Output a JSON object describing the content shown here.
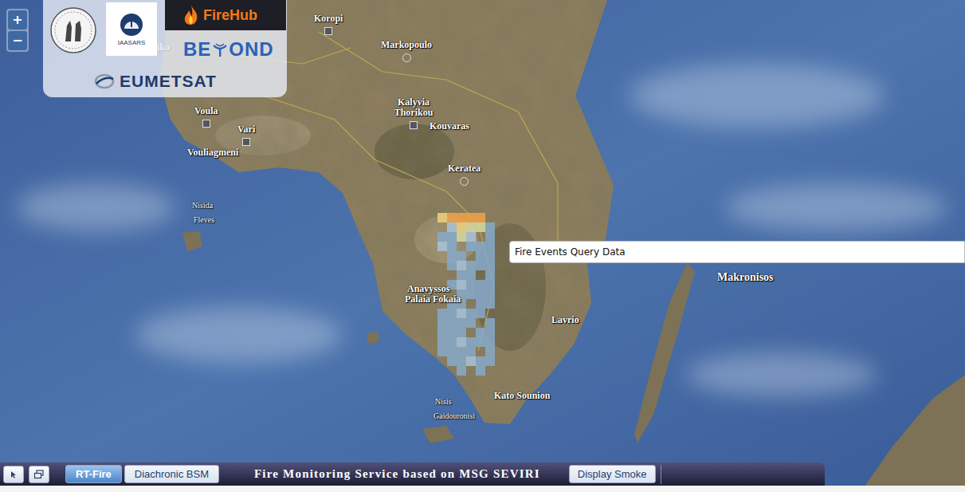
{
  "zoom": {
    "in": "+",
    "out": "−"
  },
  "logos": {
    "iaasars": "IAASARS",
    "firehub": "FireHub",
    "beyond_left": "BE",
    "beyond_right": "OND",
    "eumetsat": "EUMETSAT"
  },
  "map_labels": [
    {
      "text": "iko",
      "kind": "town",
      "marker": "none"
    },
    {
      "text": "Koropi",
      "kind": "town",
      "marker": "square"
    },
    {
      "text": "Markopoulo",
      "kind": "town",
      "marker": "circle"
    },
    {
      "text": "Voula",
      "kind": "town",
      "marker": "square"
    },
    {
      "text": "Vari",
      "kind": "town",
      "marker": "square"
    },
    {
      "text": "Vouliagmeni",
      "kind": "town",
      "marker": "none"
    },
    {
      "text": "Kalyvia Thorikou",
      "kind": "town",
      "marker": "square"
    },
    {
      "text": "Kouvaras",
      "kind": "town",
      "marker": "none"
    },
    {
      "text": "Keratea",
      "kind": "town",
      "marker": "circle"
    },
    {
      "text": "Nisida",
      "kind": "small",
      "marker": "none"
    },
    {
      "text": "Fleves",
      "kind": "small",
      "marker": "none"
    },
    {
      "text": "Anavyssos",
      "kind": "town",
      "marker": "none"
    },
    {
      "text": "Palaia Fokaia",
      "kind": "town",
      "marker": "none"
    },
    {
      "text": "Lavrio",
      "kind": "town",
      "marker": "none"
    },
    {
      "text": "Makronisos",
      "kind": "island",
      "marker": "none"
    },
    {
      "text": "Kato Sounion",
      "kind": "town",
      "marker": "none"
    },
    {
      "text": "Nisis",
      "kind": "small",
      "marker": "none"
    },
    {
      "text": "Gaidouronisi",
      "kind": "small",
      "marker": "none"
    }
  ],
  "fire_grid": [
    [
      "#f0d27a",
      "#f4a24a",
      "#f4a24a",
      "#f4a24a",
      "#f4a24a",
      null
    ],
    [
      null,
      "#a9c4da",
      "#f0d27a",
      "#d6d9a0",
      "#d6d9a0",
      "#86aacb"
    ],
    [
      "#86aacb",
      "#86aacb",
      "#d6d9a0",
      "#a9c4da",
      null,
      "#86aacb"
    ],
    [
      "#a9c4da",
      "#86aacb",
      null,
      "#86aacb",
      "#86aacb",
      "#86aacb"
    ],
    [
      null,
      "#86aacb",
      "#86aacb",
      null,
      "#86aacb",
      "#86aacb"
    ],
    [
      null,
      "#86aacb",
      "#a9c4da",
      "#86aacb",
      "#86aacb",
      "#86aacb"
    ],
    [
      null,
      null,
      "#86aacb",
      "#86aacb",
      null,
      "#86aacb"
    ],
    [
      null,
      "#86aacb",
      "#a9c4da",
      "#86aacb",
      "#86aacb",
      "#86aacb"
    ],
    [
      null,
      null,
      "#86aacb",
      "#86aacb",
      "#86aacb",
      "#86aacb"
    ],
    [
      null,
      "#86aacb",
      "#86aacb",
      null,
      "#86aacb",
      "#86aacb"
    ],
    [
      "#86aacb",
      "#86aacb",
      "#a9c4da",
      "#86aacb",
      "#86aacb",
      null
    ],
    [
      "#86aacb",
      "#86aacb",
      "#86aacb",
      "#86aacb",
      null,
      "#86aacb"
    ],
    [
      "#86aacb",
      "#86aacb",
      "#86aacb",
      null,
      "#86aacb",
      "#86aacb"
    ],
    [
      "#86aacb",
      "#86aacb",
      "#a9c4da",
      "#86aacb",
      "#86aacb",
      "#86aacb"
    ],
    [
      "#86aacb",
      "#86aacb",
      "#86aacb",
      "#86aacb",
      null,
      "#86aacb"
    ],
    [
      null,
      "#86aacb",
      "#86aacb",
      "#a9c4da",
      "#86aacb",
      "#86aacb"
    ],
    [
      null,
      null,
      "#86aacb",
      null,
      "#86aacb",
      null
    ]
  ],
  "tooltip": "Fire Events Query Data",
  "toolbar": {
    "tabs": [
      {
        "label": "RT-Fire",
        "selected": true
      },
      {
        "label": "Diachronic BSM",
        "selected": false
      }
    ],
    "title": "Fire Monitoring Service based on MSG SEVIRI",
    "toggle": {
      "label": "Display Smoke",
      "on": false
    }
  }
}
